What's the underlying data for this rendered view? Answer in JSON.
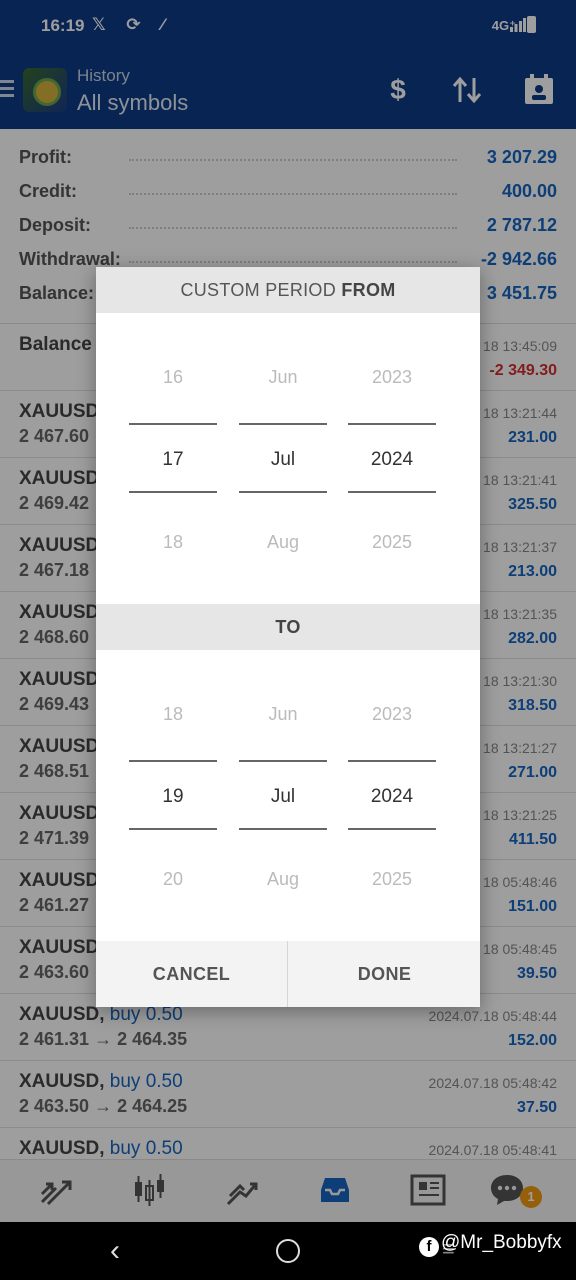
{
  "status_bar": {
    "time": "16:19",
    "icons": "𝕏 ⟳ ⁄",
    "network": "4G⁺"
  },
  "app_bar": {
    "subtitle": "History",
    "title": "All symbols"
  },
  "summary": [
    {
      "label": "Profit:",
      "value": "3 207.29"
    },
    {
      "label": "Credit:",
      "value": "400.00"
    },
    {
      "label": "Deposit:",
      "value": "2 787.12"
    },
    {
      "label": "Withdrawal:",
      "value": "-2 942.66"
    },
    {
      "label": "Balance:",
      "value": "3 451.75"
    }
  ],
  "deals": [
    {
      "symbol": "Balance",
      "side": "",
      "price": "",
      "datetime": "18 13:45:09",
      "pnl": "-2 349.30",
      "negative": true
    },
    {
      "symbol": "XAUUSD,",
      "side": "",
      "price": "2 467.60",
      "datetime": "18 13:21:44",
      "pnl": "231.00"
    },
    {
      "symbol": "XAUUSD,",
      "side": "",
      "price": "2 469.42",
      "datetime": "18 13:21:41",
      "pnl": "325.50"
    },
    {
      "symbol": "XAUUSD,",
      "side": "",
      "price": "2 467.18",
      "datetime": "18 13:21:37",
      "pnl": "213.00"
    },
    {
      "symbol": "XAUUSD,",
      "side": "",
      "price": "2 468.60",
      "datetime": "18 13:21:35",
      "pnl": "282.00"
    },
    {
      "symbol": "XAUUSD,",
      "side": "",
      "price": "2 469.43",
      "datetime": "18 13:21:30",
      "pnl": "318.50"
    },
    {
      "symbol": "XAUUSD,",
      "side": "",
      "price": "2 468.51",
      "datetime": "18 13:21:27",
      "pnl": "271.00"
    },
    {
      "symbol": "XAUUSD,",
      "side": "",
      "price": "2 471.39",
      "datetime": "18 13:21:25",
      "pnl": "411.50"
    },
    {
      "symbol": "XAUUSD,",
      "side": "",
      "price": "2 461.27",
      "datetime": "18 05:48:46",
      "pnl": "151.00"
    },
    {
      "symbol": "XAUUSD,",
      "side": "",
      "price": "2 463.60",
      "datetime": "18 05:48:45",
      "pnl": "39.50"
    },
    {
      "symbol": "XAUUSD,",
      "side": " buy 0.50",
      "price": "2 461.31 → 2 464.35",
      "datetime": "2024.07.18 05:48:44",
      "pnl": "152.00"
    },
    {
      "symbol": "XAUUSD,",
      "side": " buy 0.50",
      "price": "2 463.50 → 2 464.25",
      "datetime": "2024.07.18 05:48:42",
      "pnl": "37.50"
    },
    {
      "symbol": "XAUUSD,",
      "side": " buy 0.50",
      "price": "",
      "datetime": "2024.07.18 05:48:41",
      "pnl": ""
    }
  ],
  "dialog": {
    "from_title_prefix": "CUSTOM PERIOD ",
    "from_title_bold": "FROM",
    "to_title": "TO",
    "from": {
      "day": {
        "prev": "16",
        "selected": "17",
        "next": "18"
      },
      "month": {
        "prev": "Jun",
        "selected": "Jul",
        "next": "Aug"
      },
      "year": {
        "prev": "2023",
        "selected": "2024",
        "next": "2025"
      }
    },
    "to": {
      "day": {
        "prev": "18",
        "selected": "19",
        "next": "20"
      },
      "month": {
        "prev": "Jun",
        "selected": "Jul",
        "next": "Aug"
      },
      "year": {
        "prev": "2023",
        "selected": "2024",
        "next": "2025"
      }
    },
    "cancel_label": "CANCEL",
    "done_label": "DONE"
  },
  "bottom_nav": {
    "badge": "1"
  },
  "watermark": "@Mr_Bobbyfx"
}
